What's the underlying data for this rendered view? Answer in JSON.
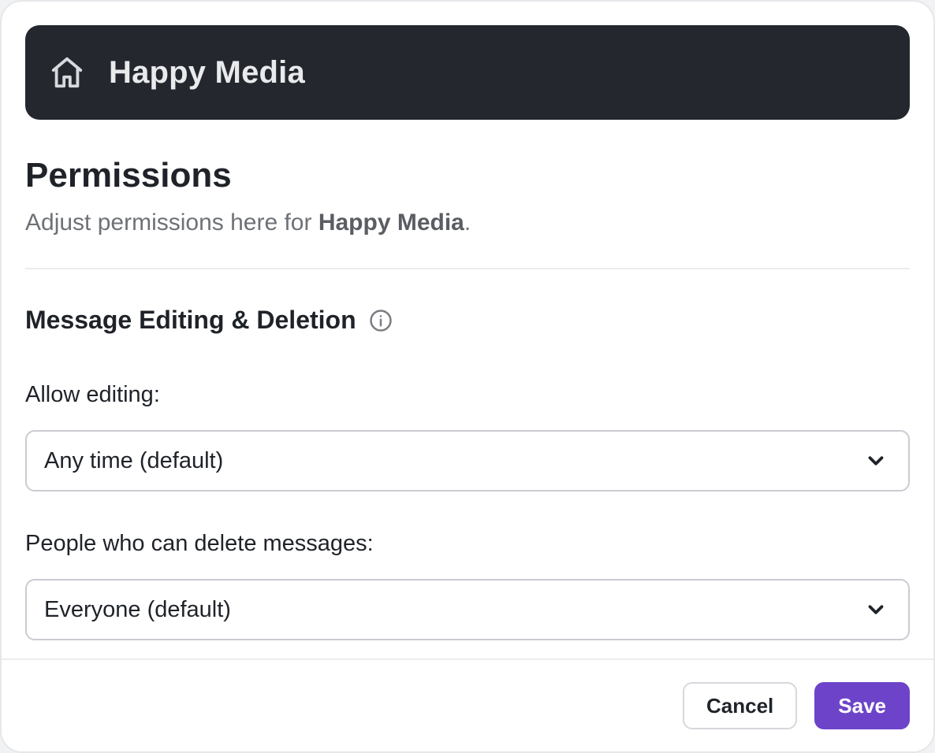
{
  "header": {
    "workspace_name": "Happy Media"
  },
  "page": {
    "title": "Permissions",
    "subtitle_prefix": "Adjust permissions here for ",
    "subtitle_subject": "Happy Media",
    "subtitle_suffix": "."
  },
  "section": {
    "heading": "Message Editing & Deletion",
    "allow_editing_label": "Allow editing:",
    "allow_editing_value": "Any time (default)",
    "delete_label": "People who can delete messages:",
    "delete_value": "Everyone (default)"
  },
  "footer": {
    "cancel_label": "Cancel",
    "save_label": "Save"
  },
  "colors": {
    "accent": "#6d44c9",
    "header_bg": "#24272e",
    "border": "#c9ccd2",
    "text_muted": "#6e7176"
  }
}
